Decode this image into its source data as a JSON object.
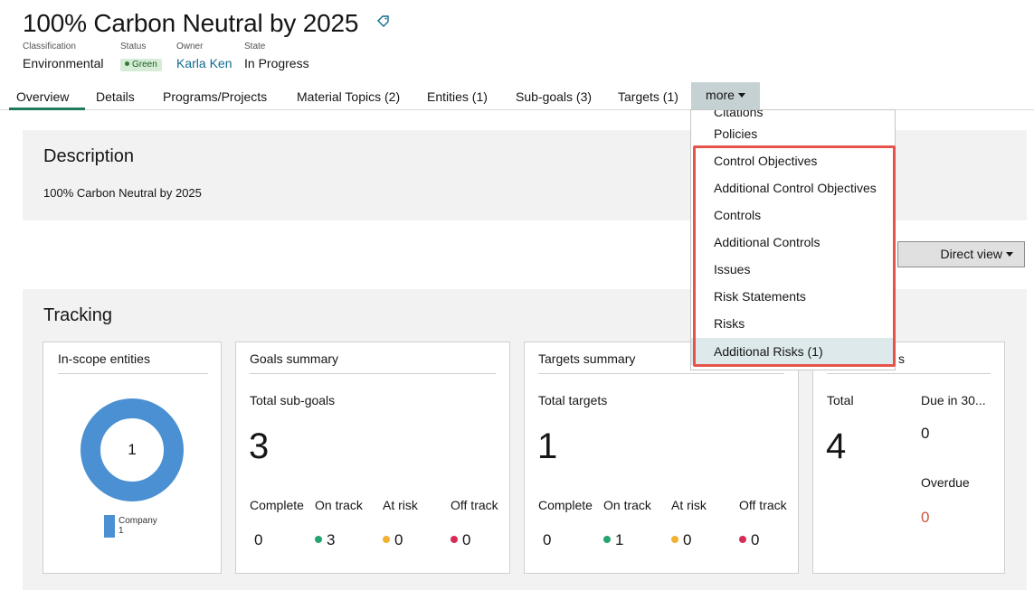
{
  "header": {
    "title": "100% Carbon Neutral by 2025",
    "meta": {
      "classification_label": "Classification",
      "classification_value": "Environmental",
      "status_label": "Status",
      "status_value": "Green",
      "owner_label": "Owner",
      "owner_value": "Karla Ken",
      "state_label": "State",
      "state_value": "In Progress"
    }
  },
  "tabs": [
    "Overview",
    "Details",
    "Programs/Projects",
    "Material Topics (2)",
    "Entities (1)",
    "Sub-goals (3)",
    "Targets (1)"
  ],
  "more_label": "more",
  "more_menu": {
    "items": [
      "Citations",
      "Policies",
      "Control Objectives",
      "Additional Control Objectives",
      "Controls",
      "Additional Controls",
      "Issues",
      "Risk Statements",
      "Risks",
      "Additional Risks (1)"
    ],
    "selected": "Additional Risks (1)"
  },
  "description": {
    "title": "Description",
    "text": "100% Carbon Neutral by 2025"
  },
  "view_button": "Direct view",
  "tracking": {
    "title": "Tracking",
    "entities": {
      "title": "In-scope entities",
      "center_value": "1",
      "legend_label": "Company",
      "legend_value": "1"
    },
    "goals": {
      "title": "Goals summary",
      "sub_label": "Total sub-goals",
      "total": "3",
      "labels": [
        "Complete",
        "On track",
        "At risk",
        "Off track"
      ],
      "values": [
        "0",
        "3",
        "0",
        "0"
      ]
    },
    "targets": {
      "title": "Targets summary",
      "sub_label": "Total targets",
      "total": "1",
      "labels": [
        "Complete",
        "On track",
        "At risk",
        "Off track"
      ],
      "values": [
        "0",
        "1",
        "0",
        "0"
      ]
    },
    "fourth": {
      "title_tail": "s",
      "total_label": "Total",
      "total_value": "4",
      "due_label": "Due in 30...",
      "due_value": "0",
      "overdue_label": "Overdue",
      "overdue_value": "0"
    }
  },
  "colors": {
    "accent_green": "#1f7a5a",
    "link": "#0f6b8e",
    "donut": "#4a90d2",
    "on_track": "#24a56f",
    "at_risk": "#f1b232",
    "off_track": "#d92c55",
    "overdue": "#d0533e",
    "highlight": "#e5534b"
  }
}
